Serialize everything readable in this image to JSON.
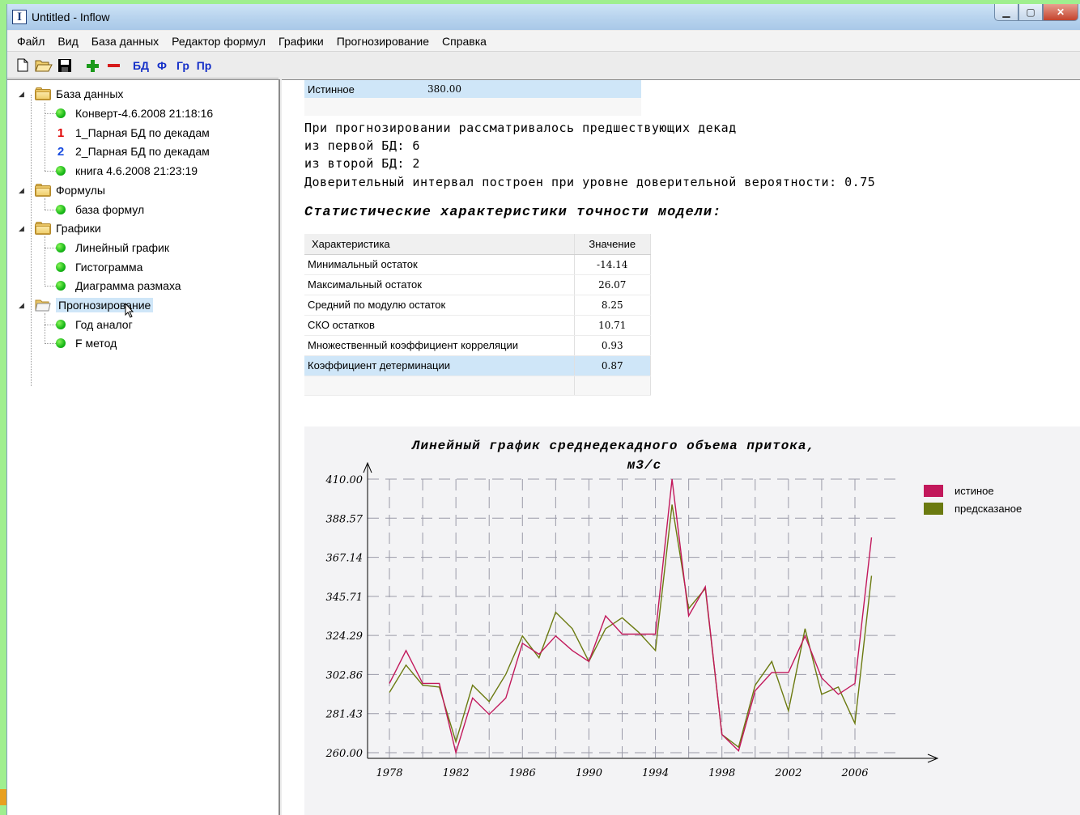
{
  "window": {
    "title": "Untitled - Inflow",
    "app_icon": "I"
  },
  "menu": [
    "Файл",
    "Вид",
    "База данных",
    "Редактор формул",
    "Графики",
    "Прогнозирование",
    "Справка"
  ],
  "toolbar": {
    "db": "БД",
    "formula": "Ф",
    "graph": "Гр",
    "forecast": "Пр"
  },
  "tree": {
    "db_root": "База данных",
    "db_items": [
      "Конверт-4.6.2008 21:18:16",
      "1_Парная БД по декадам",
      "2_Парная БД по декадам",
      "книга 4.6.2008 21:23:19"
    ],
    "db_nums": [
      "1",
      "2"
    ],
    "formulas_root": "Формулы",
    "formula_items": [
      "база формул"
    ],
    "charts_root": "Графики",
    "chart_items": [
      "Линейный график",
      "Гистограмма",
      "Диаграмма размаха"
    ],
    "forecast_root": "Прогнозирование",
    "forecast_items": [
      "Год аналог",
      "F метод"
    ]
  },
  "content": {
    "true_label": "Истинное",
    "true_value": "380.00",
    "lines": [
      "При прогнозировании рассматривалось предшествующих декад",
      "из первой БД: 6",
      "из второй БД: 2",
      "Доверительный интервал построен при уровне доверительной вероятности: 0.75"
    ],
    "stats_title": "Статистические характеристики точности модели:",
    "stats_header": {
      "name": "Характеристика",
      "value": "Значение"
    },
    "stats": [
      {
        "name": "Минимальный остаток",
        "value": "-14.14"
      },
      {
        "name": "Максимальный остаток",
        "value": "26.07"
      },
      {
        "name": "Средний по модулю остаток",
        "value": "8.25"
      },
      {
        "name": "СКО остатков",
        "value": "10.71"
      },
      {
        "name": "Множественный коэффициент корреляции",
        "value": "0.93"
      },
      {
        "name": "Коэффициент детерминации",
        "value": "0.87"
      }
    ]
  },
  "colors": {
    "true_series": "#c2185b",
    "predicted_series": "#6b7a10",
    "selection": "#cfe6f8"
  },
  "chart_data": {
    "type": "line",
    "title": "Линейный график среднедекадного объема притока,",
    "title_line2": "м3/с",
    "ytick_labels": [
      "410.00",
      "388.57",
      "367.14",
      "345.71",
      "324.29",
      "302.86",
      "281.43",
      "260.00"
    ],
    "xtick_labels": [
      "1978",
      "1982",
      "1986",
      "1990",
      "1994",
      "1998",
      "2002",
      "2006"
    ],
    "ylim": [
      260,
      410
    ],
    "xlim": [
      1978,
      2006
    ],
    "grid": true,
    "legend_position": "top-right",
    "x": [
      1978,
      1979,
      1980,
      1981,
      1982,
      1983,
      1984,
      1985,
      1986,
      1987,
      1988,
      1989,
      1990,
      1991,
      1992,
      1993,
      1994,
      1995,
      1996,
      1997,
      1998,
      1999,
      2000,
      2001,
      2002,
      2003,
      2004,
      2005,
      2006,
      2007
    ],
    "series": [
      {
        "name": "истиное",
        "values": [
          298,
          316,
          298,
          298,
          260,
          290,
          281,
          290,
          320,
          314,
          324,
          316,
          310,
          335,
          325,
          325,
          325,
          410,
          335,
          351,
          270,
          261,
          294,
          304,
          304,
          324,
          301,
          292,
          298,
          378
        ]
      },
      {
        "name": "предсказаное",
        "values": [
          293,
          308,
          297,
          296,
          266,
          297,
          288,
          303,
          324,
          312,
          337,
          328,
          310,
          328,
          334,
          326,
          316,
          396,
          339,
          350,
          270,
          263,
          297,
          310,
          283,
          328,
          292,
          296,
          276,
          357
        ]
      }
    ]
  }
}
